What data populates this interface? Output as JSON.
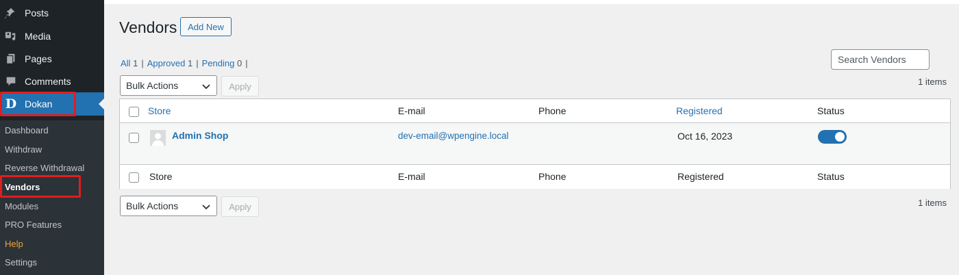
{
  "sidebar": {
    "items": [
      {
        "label": "Posts",
        "icon": "pin-icon"
      },
      {
        "label": "Media",
        "icon": "media-icon"
      },
      {
        "label": "Pages",
        "icon": "pages-icon"
      },
      {
        "label": "Comments",
        "icon": "comment-icon"
      },
      {
        "label": "Dokan",
        "icon": "dokan-logo-icon"
      }
    ],
    "dokan_logo_letter": "D",
    "submenu": [
      "Dashboard",
      "Withdraw",
      "Reverse Withdrawal",
      "Vendors",
      "Modules",
      "PRO Features",
      "Help",
      "Settings"
    ]
  },
  "page": {
    "title": "Vendors",
    "add_new_label": "Add New"
  },
  "filters": {
    "all_label": "All",
    "all_count": "1",
    "approved_label": "Approved",
    "approved_count": "1",
    "pending_label": "Pending",
    "pending_count": "0",
    "separator": "|"
  },
  "search": {
    "placeholder": "Search Vendors"
  },
  "bulk": {
    "label": "Bulk Actions",
    "apply_label": "Apply"
  },
  "items_count": "1 items",
  "table": {
    "columns": [
      "Store",
      "E-mail",
      "Phone",
      "Registered",
      "Status"
    ],
    "rows": [
      {
        "store": "Admin Shop",
        "email": "dev-email@wpengine.local",
        "phone": "",
        "registered": "Oct 16, 2023",
        "status_enabled": true
      }
    ]
  },
  "colors": {
    "accent": "#2271b1",
    "highlight": "#e11d1d",
    "sidebar": "#1d2327",
    "help": "#f0a43c"
  }
}
